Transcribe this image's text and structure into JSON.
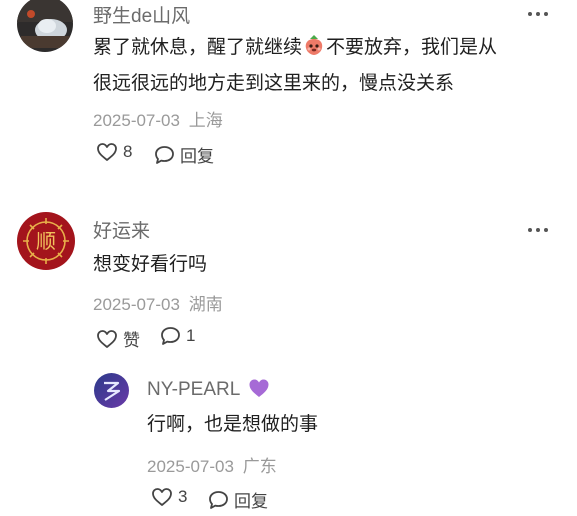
{
  "comments": [
    {
      "author": "野生de山风",
      "text_line1_a": "累了就休息，醒了就继续",
      "text_line1_emoji": "strawberry-face-emoji",
      "text_line1_b": "不要放弃，我们是从",
      "text_line2": "很远很远的地方走到这里来的，慢点没关系",
      "date": "2025-07-03",
      "location": "上海",
      "like_count": "8",
      "reply_label": "回复"
    },
    {
      "author": "好运来",
      "text": "想变好看行吗",
      "date": "2025-07-03",
      "location": "湖南",
      "like_label": "赞",
      "reply_count": "1",
      "avatar_char": "顺"
    }
  ],
  "reply": {
    "author": "NY-PEARL",
    "badge_icon": "purple-heart-icon",
    "text": "行啊，也是想做的事",
    "date": "2025-07-03",
    "location": "广东",
    "like_count": "3",
    "reply_label": "回复"
  },
  "colors": {
    "meta_gray": "#9a9a9a",
    "name_gray": "#6b6b6b",
    "avatar2_red": "#a3141c",
    "heart_purple": "#a66ad6"
  }
}
